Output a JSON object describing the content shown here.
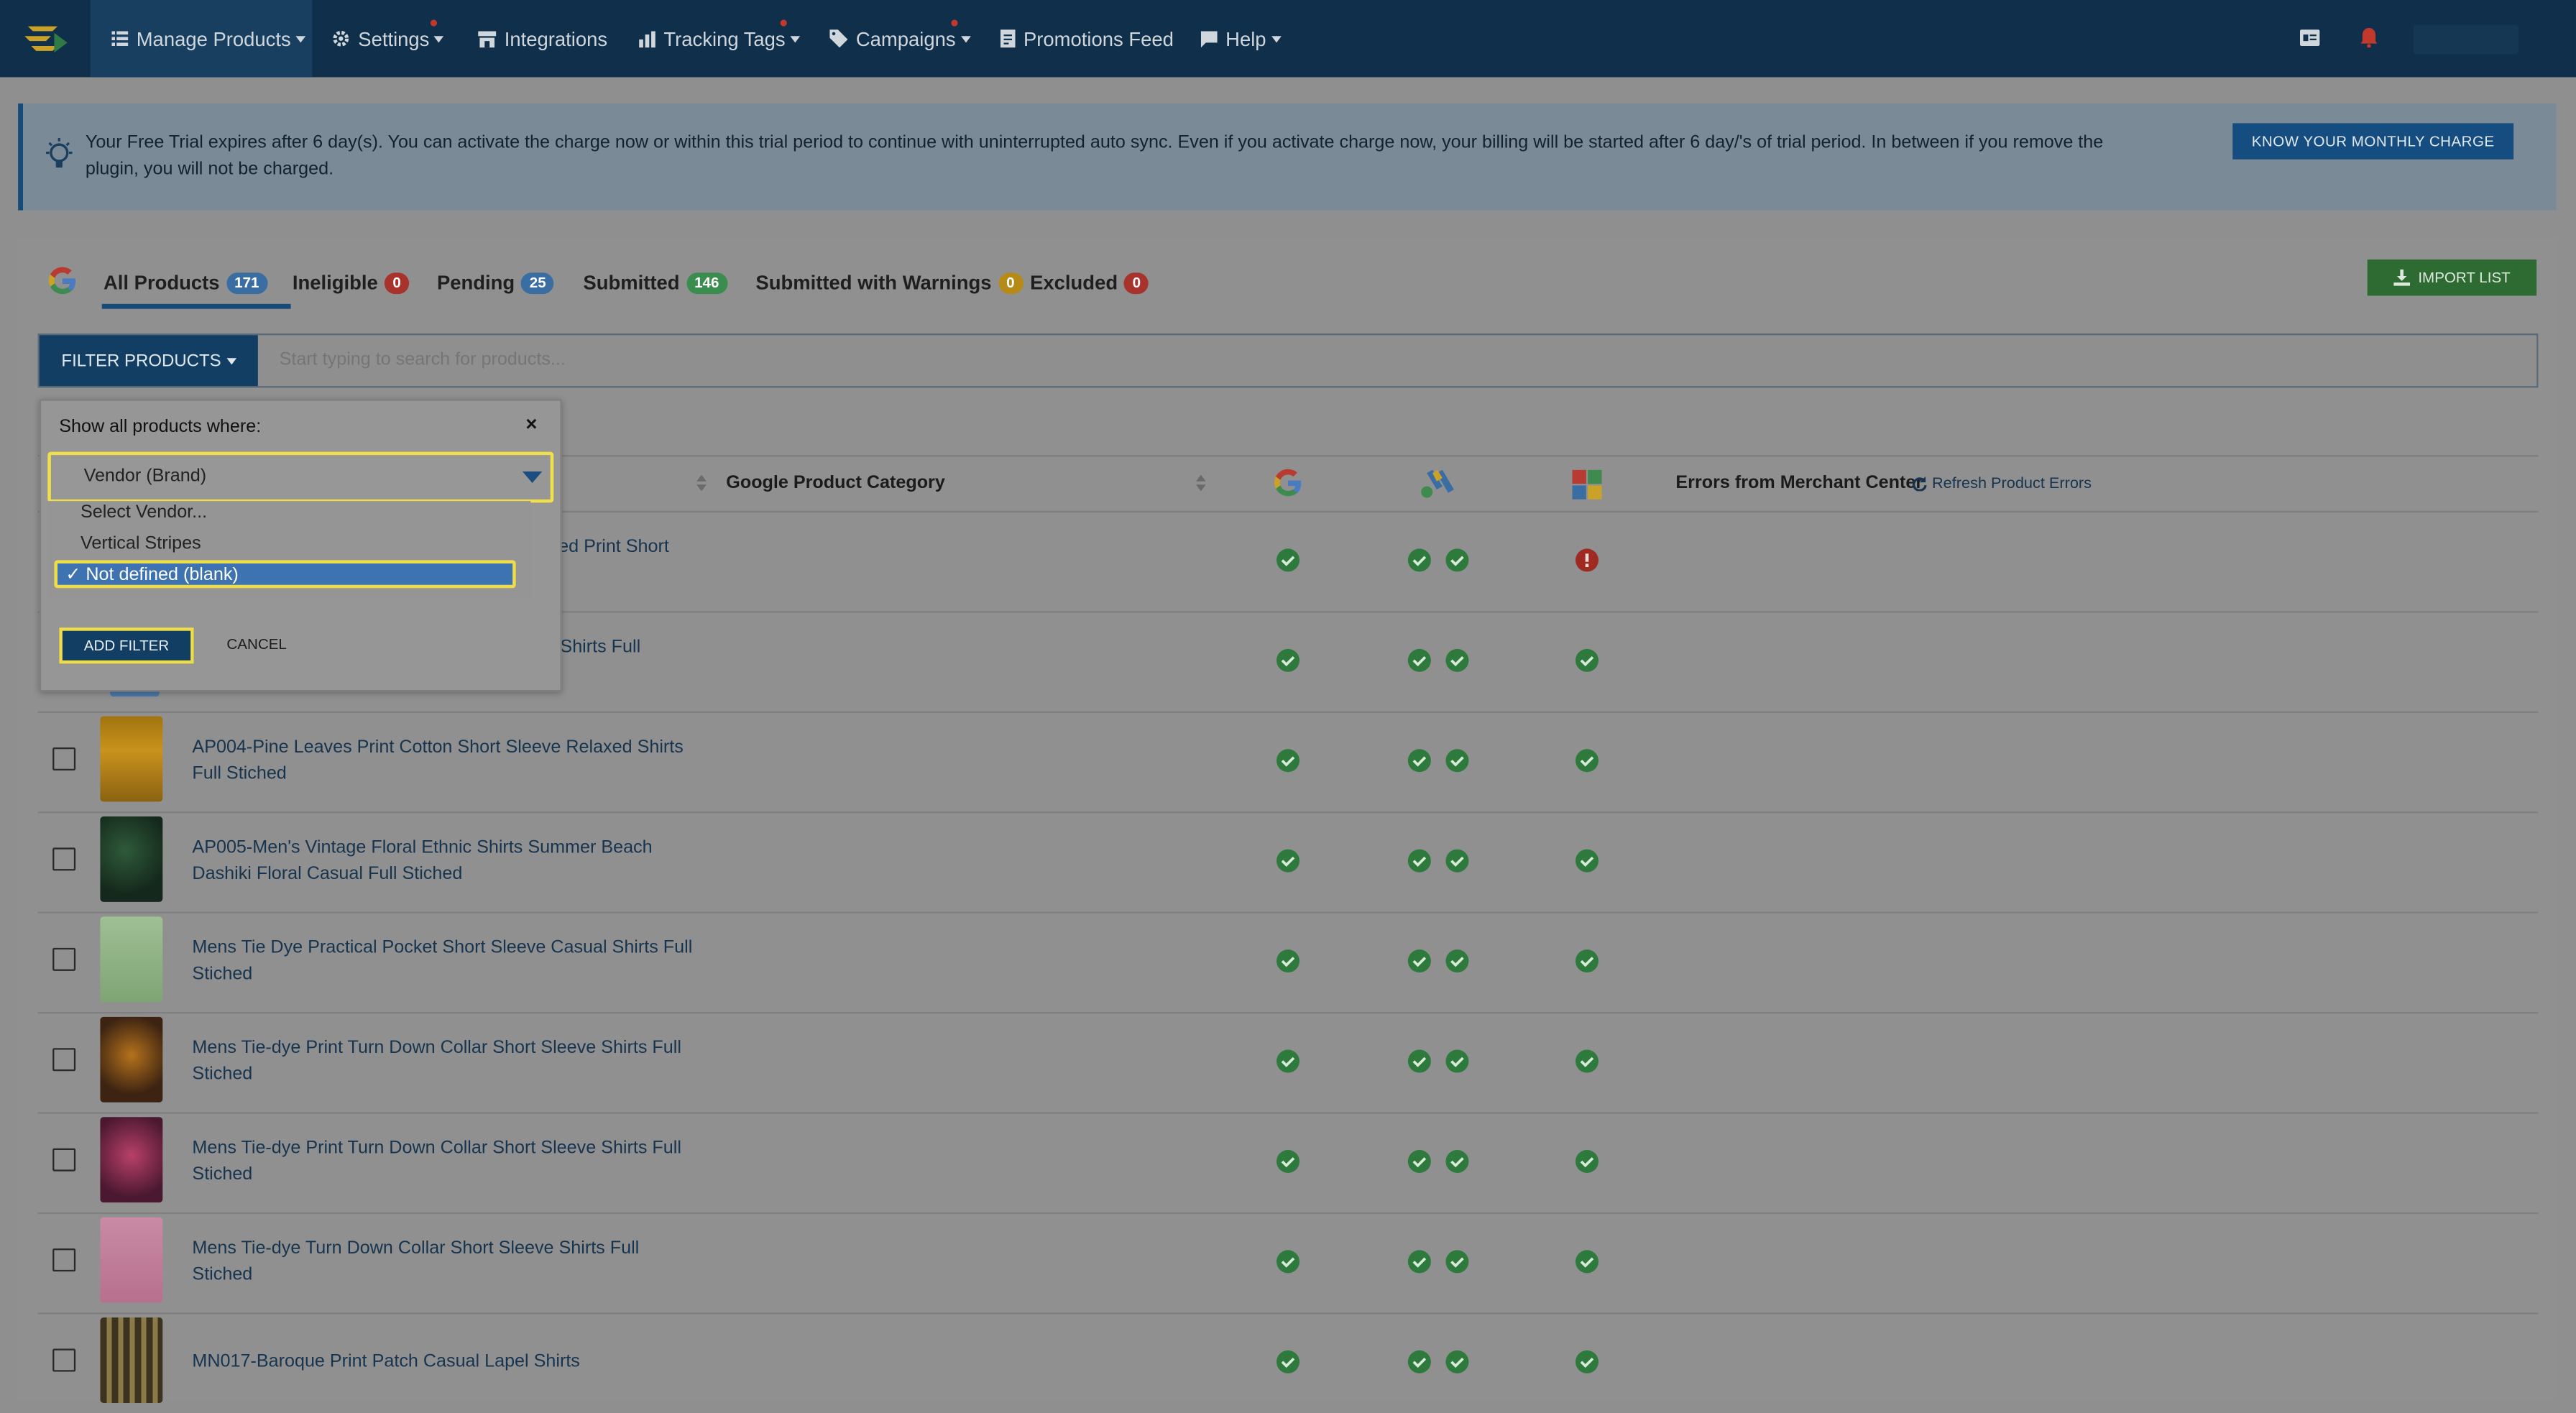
{
  "nav": {
    "items": [
      {
        "label": "Manage Products"
      },
      {
        "label": "Settings"
      },
      {
        "label": "Integrations"
      },
      {
        "label": "Tracking Tags"
      },
      {
        "label": "Campaigns"
      },
      {
        "label": "Promotions Feed"
      },
      {
        "label": "Help"
      }
    ]
  },
  "banner": {
    "text": "Your Free Trial expires after 6 day(s). You can activate the charge now or within this trial period to continue with uninterrupted auto sync. Even if you activate charge now, your billing will be started after 6 day/'s of trial period. In between if you remove the plugin, you will not be charged.",
    "button": "KNOW YOUR MONTHLY CHARGE"
  },
  "tabs": [
    {
      "label": "All Products",
      "count": "171",
      "color": "#3a6ea3"
    },
    {
      "label": "Ineligible",
      "count": "0",
      "color": "#a8332c"
    },
    {
      "label": "Pending",
      "count": "25",
      "color": "#3a6ea3"
    },
    {
      "label": "Submitted",
      "count": "146",
      "color": "#3a8c4f"
    },
    {
      "label": "Submitted with Warnings",
      "count": "0",
      "color": "#b58a17"
    },
    {
      "label": "Excluded",
      "count": "0",
      "color": "#a8332c"
    }
  ],
  "import_button": "IMPORT LIST",
  "filter": {
    "button": "FILTER PRODUCTS",
    "search_placeholder": "Start typing to search for products..."
  },
  "table": {
    "col_category": "Google Product Category",
    "col_errors": "Errors from Merchant Center",
    "refresh_label": "Refresh Product Errors",
    "partial_rows": [
      {
        "name_tail": "ed Print Short"
      },
      {
        "name_tail": "Shirts Full"
      }
    ],
    "rows": [
      {
        "name": "AP004-Pine Leaves Print Cotton Short Sleeve Relaxed Shirts Full Stiched"
      },
      {
        "name": "AP005-Men's Vintage Floral Ethnic Shirts Summer Beach Dashiki Floral Casual Full Stiched"
      },
      {
        "name": "Mens Tie Dye Practical Pocket Short Sleeve Casual Shirts Full Stiched"
      },
      {
        "name": "Mens Tie-dye Print Turn Down Collar Short Sleeve Shirts Full Stiched"
      },
      {
        "name": "Mens Tie-dye Print Turn Down Collar Short Sleeve Shirts Full Stiched"
      },
      {
        "name": "Mens Tie-dye Turn Down Collar Short Sleeve Shirts Full Stiched"
      },
      {
        "name": "MN017-Baroque Print Patch Casual Lapel Shirts"
      }
    ]
  },
  "popup": {
    "title": "Show all products where:",
    "close": "×",
    "select_value": "Vendor (Brand)",
    "options": [
      "Select Vendor...",
      "Vertical Stripes"
    ],
    "selected_option": "Not defined (blank)",
    "add_button": "ADD FILTER",
    "cancel_button": "CANCEL"
  }
}
